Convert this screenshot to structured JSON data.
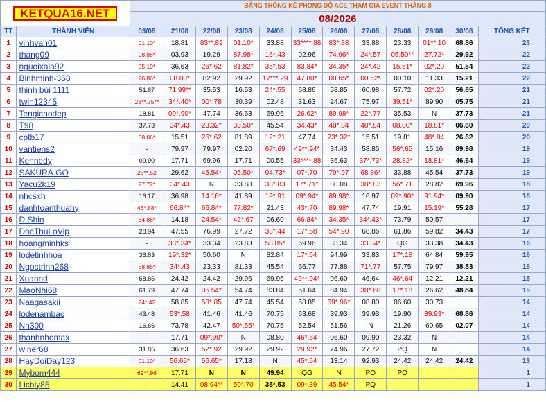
{
  "logo": "KETQUA16.NET",
  "title": "BẢNG THỐNG KÊ PHONG ĐỘ ACE THAM GIA EVENT THÁNG 8",
  "month": "08/2026",
  "headers": {
    "tt": "TT",
    "member": "THÀNH VIÊN",
    "dates": [
      "03/08",
      "21/08",
      "22/08",
      "23/08",
      "24/08",
      "25/08",
      "26/08",
      "27/08",
      "28/08",
      "29/08",
      "30/08"
    ],
    "total": "TỔNG KẾT"
  },
  "rows": [
    {
      "tt": "1",
      "name": "vinhvan01",
      "cells": [
        "01.10*",
        "18.81",
        "83**.89",
        "01.10*",
        "33.88",
        "33****.88",
        "83*.88",
        "33.88",
        "23.33",
        "01**.10",
        "68.86"
      ],
      "total": "23"
    },
    {
      "tt": "2",
      "name": "thang09",
      "cells": [
        "08.88*",
        "03.93",
        "19.29",
        "87.98*",
        "16*.43",
        "02.96",
        "74.96*",
        "24*.57",
        "05.50**",
        "27.72*",
        "29.92"
      ],
      "total": "22"
    },
    {
      "tt": "3",
      "name": "nguoixala92",
      "cells": [
        "05.10*",
        "36.63",
        "26*.62",
        "81.82*",
        "35*.53",
        "83.84*",
        "34.35*",
        "24*.42",
        "15.51*",
        "02*.20",
        "51.54"
      ],
      "total": "22"
    },
    {
      "tt": "4",
      "name": "Binhminh-368",
      "cells": [
        "26.86*",
        "08.80*",
        "82.92",
        "29.92",
        "17***.29",
        "47.80*",
        "00.65*",
        "00.52*",
        "00.10",
        "11.33",
        "15.21"
      ],
      "total": "22"
    },
    {
      "tt": "5",
      "name": "thinh bùi 1111",
      "cells": [
        "51.87",
        "71.99**",
        "35.53",
        "16.53",
        "24*.55",
        "68.86",
        "58.85",
        "60.98",
        "57.72",
        "02*.20",
        "56.65"
      ],
      "total": "21"
    },
    {
      "tt": "6",
      "name": "twin12345",
      "cells": [
        "23**.75**",
        "34*.40*",
        "00*.78",
        "30.39",
        "02.48",
        "31.63",
        "24.67",
        "75.97",
        "39.51*",
        "89.90",
        "05.75"
      ],
      "total": "21"
    },
    {
      "tt": "7",
      "name": "Tengichodep",
      "cells": [
        "18.81",
        "09*.90*",
        "47.74",
        "36.63",
        "69.96",
        "26.62*",
        "89.98*",
        "22*.77",
        "35.53",
        "N",
        "37.73"
      ],
      "total": "21"
    },
    {
      "tt": "8",
      "name": "T98",
      "cells": [
        "37.73",
        "34*.43",
        "23.32*",
        "33.50*",
        "45.54",
        "34.43*",
        "48*.84",
        "48*.84",
        "08.80*",
        "18.81*",
        "06.60"
      ],
      "total": "20"
    },
    {
      "tt": "9",
      "name": "cptb17",
      "cells": [
        "68.86*",
        "15.51",
        "26*.62",
        "81.89",
        "12*.21",
        "47.74",
        "23*.32*",
        "15.51",
        "19.81",
        "48*.84",
        "26.62"
      ],
      "total": "20"
    },
    {
      "tt": "10",
      "name": "vantiens2",
      "cells": [
        "-",
        "79.97",
        "79.97",
        "02.20",
        "67*.69",
        "49**.94*",
        "34.43",
        "58.85",
        "56*.65",
        "15.16",
        "89.98"
      ],
      "total": "19"
    },
    {
      "tt": "11",
      "name": "Kennedy",
      "cells": [
        "09.90",
        "17.71",
        "69.96",
        "17.71",
        "00.55",
        "33****.88",
        "36.63",
        "37*.73*",
        "28.82*",
        "18.81*",
        "46.64"
      ],
      "total": "19"
    },
    {
      "tt": "12",
      "name": "SAKURA.GO",
      "cells": [
        "25**.52",
        "29.62",
        "45.54*",
        "05.50*",
        "04.73*",
        "07*.70",
        "79*.97",
        "68.86*",
        "33.88",
        "45.54",
        "37.73"
      ],
      "total": "19"
    },
    {
      "tt": "13",
      "name": "Yacu2k19",
      "cells": [
        "27.72*",
        "34*.43",
        "N",
        "33.88",
        "38*.83",
        "17*.71*",
        "80.08",
        "38*.83",
        "56*.71",
        "28.82",
        "69.96"
      ],
      "total": "18"
    },
    {
      "tt": "14",
      "name": "nhcsxh",
      "cells": [
        "16.17",
        "36.98",
        "14.16*",
        "41.89",
        "19*.91",
        "09*.94*",
        "89.98*",
        "16.97",
        "09*.90*",
        "91.94*",
        "09.90"
      ],
      "total": "18"
    },
    {
      "tt": "15",
      "name": "danhtoanthuahy",
      "cells": [
        "46*.88*",
        "66.84*",
        "66.84*",
        "77.82*",
        "21.43",
        "43*.70",
        "89.98*",
        "47.74",
        "19.91",
        "15.19*",
        "55.28"
      ],
      "total": "17"
    },
    {
      "tt": "16",
      "name": "D Shin",
      "cells": [
        "84.86*",
        "14.18",
        "24.54*",
        "42*.67",
        "06.60",
        "66.84*",
        "34.35*",
        "34*.43*",
        "73.79",
        "50.57",
        ""
      ],
      "total": "17"
    },
    {
      "tt": "17",
      "name": "DocThuLoVip",
      "cells": [
        "28.94",
        "47.55",
        "76.99",
        "27.72",
        "38*.44",
        "17*.58",
        "54*.90",
        "68.86",
        "61.86",
        "59.82",
        "34.43"
      ],
      "total": "17"
    },
    {
      "tt": "18",
      "name": "hoangminhks",
      "cells": [
        "-",
        "33*.34*",
        "33.34",
        "23.83",
        "58.85*",
        "69.96",
        "33.34",
        "33.34*",
        "QG",
        "33.38",
        "34.43"
      ],
      "total": "16"
    },
    {
      "tt": "19",
      "name": "lodetinhhoa",
      "cells": [
        "38.83",
        "19*.32*",
        "50.60",
        "N",
        "82.84",
        "17*.64",
        "94.99",
        "33.83",
        "17*.18",
        "64.84",
        "59.95"
      ],
      "total": "16"
    },
    {
      "tt": "20",
      "name": "Ngoctrinh268",
      "cells": [
        "68.86*",
        "34*.43",
        "23.33",
        "81.33",
        "45.54",
        "66.77",
        "77.88",
        "71*.77",
        "57.75",
        "79.97",
        "38.83"
      ],
      "total": "16"
    },
    {
      "tt": "21",
      "name": "Xuannd",
      "cells": [
        "58.85",
        "24.42",
        "24.42",
        "29.96",
        "69.96",
        "49**.94*",
        "06.60",
        "46.64",
        "46*.64",
        "12.21",
        "12.21"
      ],
      "total": "15"
    },
    {
      "tt": "22",
      "name": "MaoNhi68",
      "cells": [
        "61.79",
        "47.74",
        "35.54*",
        "54.74",
        "83.84",
        "51.64",
        "84.94",
        "38*.68",
        "17*.18",
        "26.62",
        "48.84"
      ],
      "total": "15"
    },
    {
      "tt": "23",
      "name": "Naagasakii",
      "cells": [
        "24*.42",
        "58.85",
        "58*.85",
        "47.74",
        "45.54",
        "58.85",
        "69*.96*",
        "08.80",
        "06.60",
        "30.73",
        ""
      ],
      "total": "14"
    },
    {
      "tt": "24",
      "name": "lodenambac",
      "cells": [
        "43.48",
        "53*.58",
        "41.46",
        "41.46",
        "70.75",
        "63.68",
        "39.93",
        "39.93",
        "19.90",
        "39.93*",
        "68.86"
      ],
      "total": "14"
    },
    {
      "tt": "25",
      "name": "Nn300",
      "cells": [
        "16.66",
        "73.78",
        "42.47",
        "50*.55*",
        "70.75",
        "52.54",
        "51.56",
        "N",
        "21.26",
        "60.65",
        "02.07"
      ],
      "total": "14"
    },
    {
      "tt": "26",
      "name": "thanhnhomax",
      "cells": [
        "-",
        "17.71",
        "09*.90*",
        "N",
        "08.80",
        "46*.64",
        "06.60",
        "09.90",
        "23.32",
        "N",
        ""
      ],
      "total": "14"
    },
    {
      "tt": "27",
      "name": "winer68",
      "cells": [
        "31.85",
        "36.63",
        "52*.92",
        "29.92",
        "29.92",
        "29.92*",
        "74.96",
        "27.72",
        "PQ",
        "N",
        ""
      ],
      "total": "14"
    },
    {
      "tt": "28",
      "name": "HayDoiDay123",
      "cells": [
        "01.10*",
        "56.65*",
        "56.65*",
        "17.18",
        "N",
        "45*.54",
        "13.14",
        "92.93",
        "24.42",
        "24.42",
        "24.42"
      ],
      "total": "13"
    },
    {
      "tt": "29",
      "name": "Mybom444",
      "cells": [
        "69**.96",
        "17.71",
        "N",
        "N",
        "49.94",
        "QG",
        "N",
        "PQ",
        "PQ",
        "",
        ""
      ],
      "total": "1"
    },
    {
      "tt": "30",
      "name": "Lichly85",
      "cells": [
        "-",
        "14.41",
        "08.94**",
        "50*.70",
        "35*.53",
        "09*.39",
        "45.54*",
        "PQ",
        "",
        "",
        ""
      ],
      "total": "1"
    }
  ]
}
